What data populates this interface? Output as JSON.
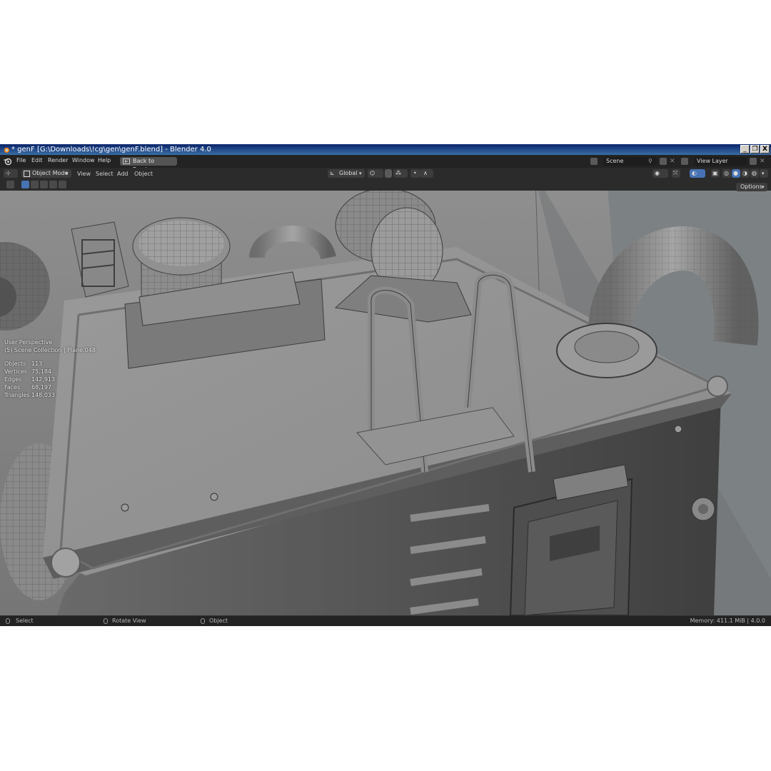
{
  "window": {
    "title": "* genF [G:\\Downloads\\!cg\\gen\\genF.blend] - Blender 4.0",
    "controls": [
      "_",
      "❐",
      "X"
    ]
  },
  "menu": {
    "items": [
      "File",
      "Edit",
      "Render",
      "Window",
      "Help"
    ],
    "back_button": "Back to Previous",
    "scene": "Scene",
    "view_layer": "View Layer"
  },
  "header": {
    "mode": "Object Mode",
    "menus": [
      "View",
      "Select",
      "Add",
      "Object"
    ],
    "orientation": "Global"
  },
  "viewport": {
    "perspective": "User Perspective",
    "collection": "(5) Scene Collection | Plane.048",
    "options_label": "Options",
    "stats": [
      {
        "label": "Objects",
        "value": "113"
      },
      {
        "label": "Vertices",
        "value": "75,184"
      },
      {
        "label": "Edges",
        "value": "142,913"
      },
      {
        "label": "Faces",
        "value": "68,197"
      },
      {
        "label": "Triangles",
        "value": "148,033"
      }
    ]
  },
  "status": {
    "select": "Select",
    "rotate": "Rotate View",
    "object": "Object",
    "memory": "Memory: 411.1 MiB | 4.0.0"
  },
  "colors": {
    "accent": "#4772b3",
    "model": "#8c8c8c",
    "background": "#303030"
  }
}
